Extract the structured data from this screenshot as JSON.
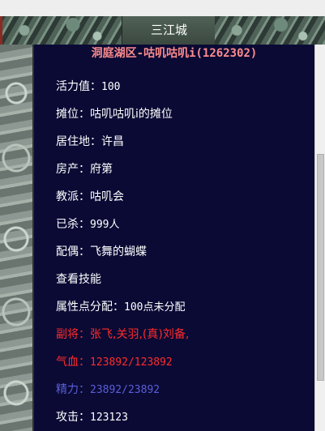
{
  "header": {
    "title": "三江城"
  },
  "location": {
    "text": "洞庭湖区-咕叽咕叽i(1262302)"
  },
  "rows": [
    {
      "label": "活力值：",
      "value": "100"
    },
    {
      "label": "摊位：",
      "value": "咕叽咕叽i的摊位"
    },
    {
      "label": "居住地：",
      "value": "许昌"
    },
    {
      "label": "房产：",
      "value": "府第"
    },
    {
      "label": "教派：",
      "value": "咕叽会"
    },
    {
      "label": "已杀：",
      "value": "999人"
    },
    {
      "label": "配偶：",
      "value": "飞舞的蝴蝶"
    },
    {
      "label": "查看技能",
      "value": ""
    },
    {
      "label": "属性点分配：",
      "value": "100点未分配"
    },
    {
      "label": "副将：",
      "value": "张飞,关羽,(真)刘备,"
    },
    {
      "label": "气血：",
      "value": "123892/123892"
    },
    {
      "label": "精力：",
      "value": "23892/23892"
    },
    {
      "label": "攻击：",
      "value": "123123"
    }
  ],
  "colors": {
    "panel_bg": "#0a0a35",
    "location_text": "#ff8c8c",
    "default_text": "#ffffff",
    "red_text": "#ff2b2b",
    "blue_text": "#5b5ed8"
  }
}
